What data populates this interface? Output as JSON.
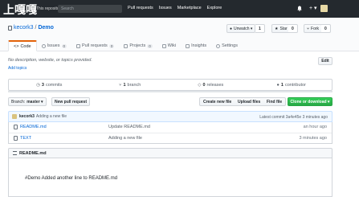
{
  "nav": {
    "logo": "上嘎嘎",
    "context": "This repository",
    "search_placeholder": "Search",
    "links": [
      "Pull requests",
      "Issues",
      "Marketplace",
      "Explore"
    ],
    "plus": "+ ▾"
  },
  "repo": {
    "owner": "kecork3",
    "separator": "/",
    "name": "Demo",
    "watch_label": "Unwatch ▾",
    "watch_count": "1",
    "star_label": "Star",
    "star_count": "0",
    "fork_label": "Fork",
    "fork_count": "0"
  },
  "tabs": [
    {
      "label": "Code"
    },
    {
      "label": "Issues",
      "count": "0"
    },
    {
      "label": "Pull requests",
      "count": "0"
    },
    {
      "label": "Projects",
      "count": "0"
    },
    {
      "label": "Wiki"
    },
    {
      "label": "Insights"
    },
    {
      "label": "Settings"
    }
  ],
  "description": {
    "text": "No description, website, or topics provided.",
    "add_topics": "Add topics",
    "edit": "Edit"
  },
  "summary": {
    "commits": "3",
    "commits_label": "commits",
    "branches": "1",
    "branches_label": "branch",
    "releases": "0",
    "releases_label": "releases",
    "contributors": "1",
    "contributors_label": "contributor"
  },
  "toolbar": {
    "branch_prefix": "Branch:",
    "branch": "master ▾",
    "new_pr": "New pull request",
    "create_file": "Create new file",
    "upload": "Upload files",
    "find": "Find file",
    "clone": "Clone or download ▾"
  },
  "commit": {
    "author": "kecork3",
    "message": "Adding a new file",
    "latest": "Latest commit 3a4e45e 3 minutes ago"
  },
  "files": [
    {
      "name": "README.md",
      "message": "Update README.md",
      "age": "an hour ago"
    },
    {
      "name": "TEXT",
      "message": "Adding a new file",
      "age": "3 minutes ago"
    }
  ],
  "readme": {
    "title": "README.md",
    "content": "#Demo Added another line to README.md"
  },
  "colors": {
    "nav_bg": "#24292e",
    "link": "#0366d6",
    "clone_green": "#28a745",
    "selected_tab_accent": "#e36209"
  }
}
